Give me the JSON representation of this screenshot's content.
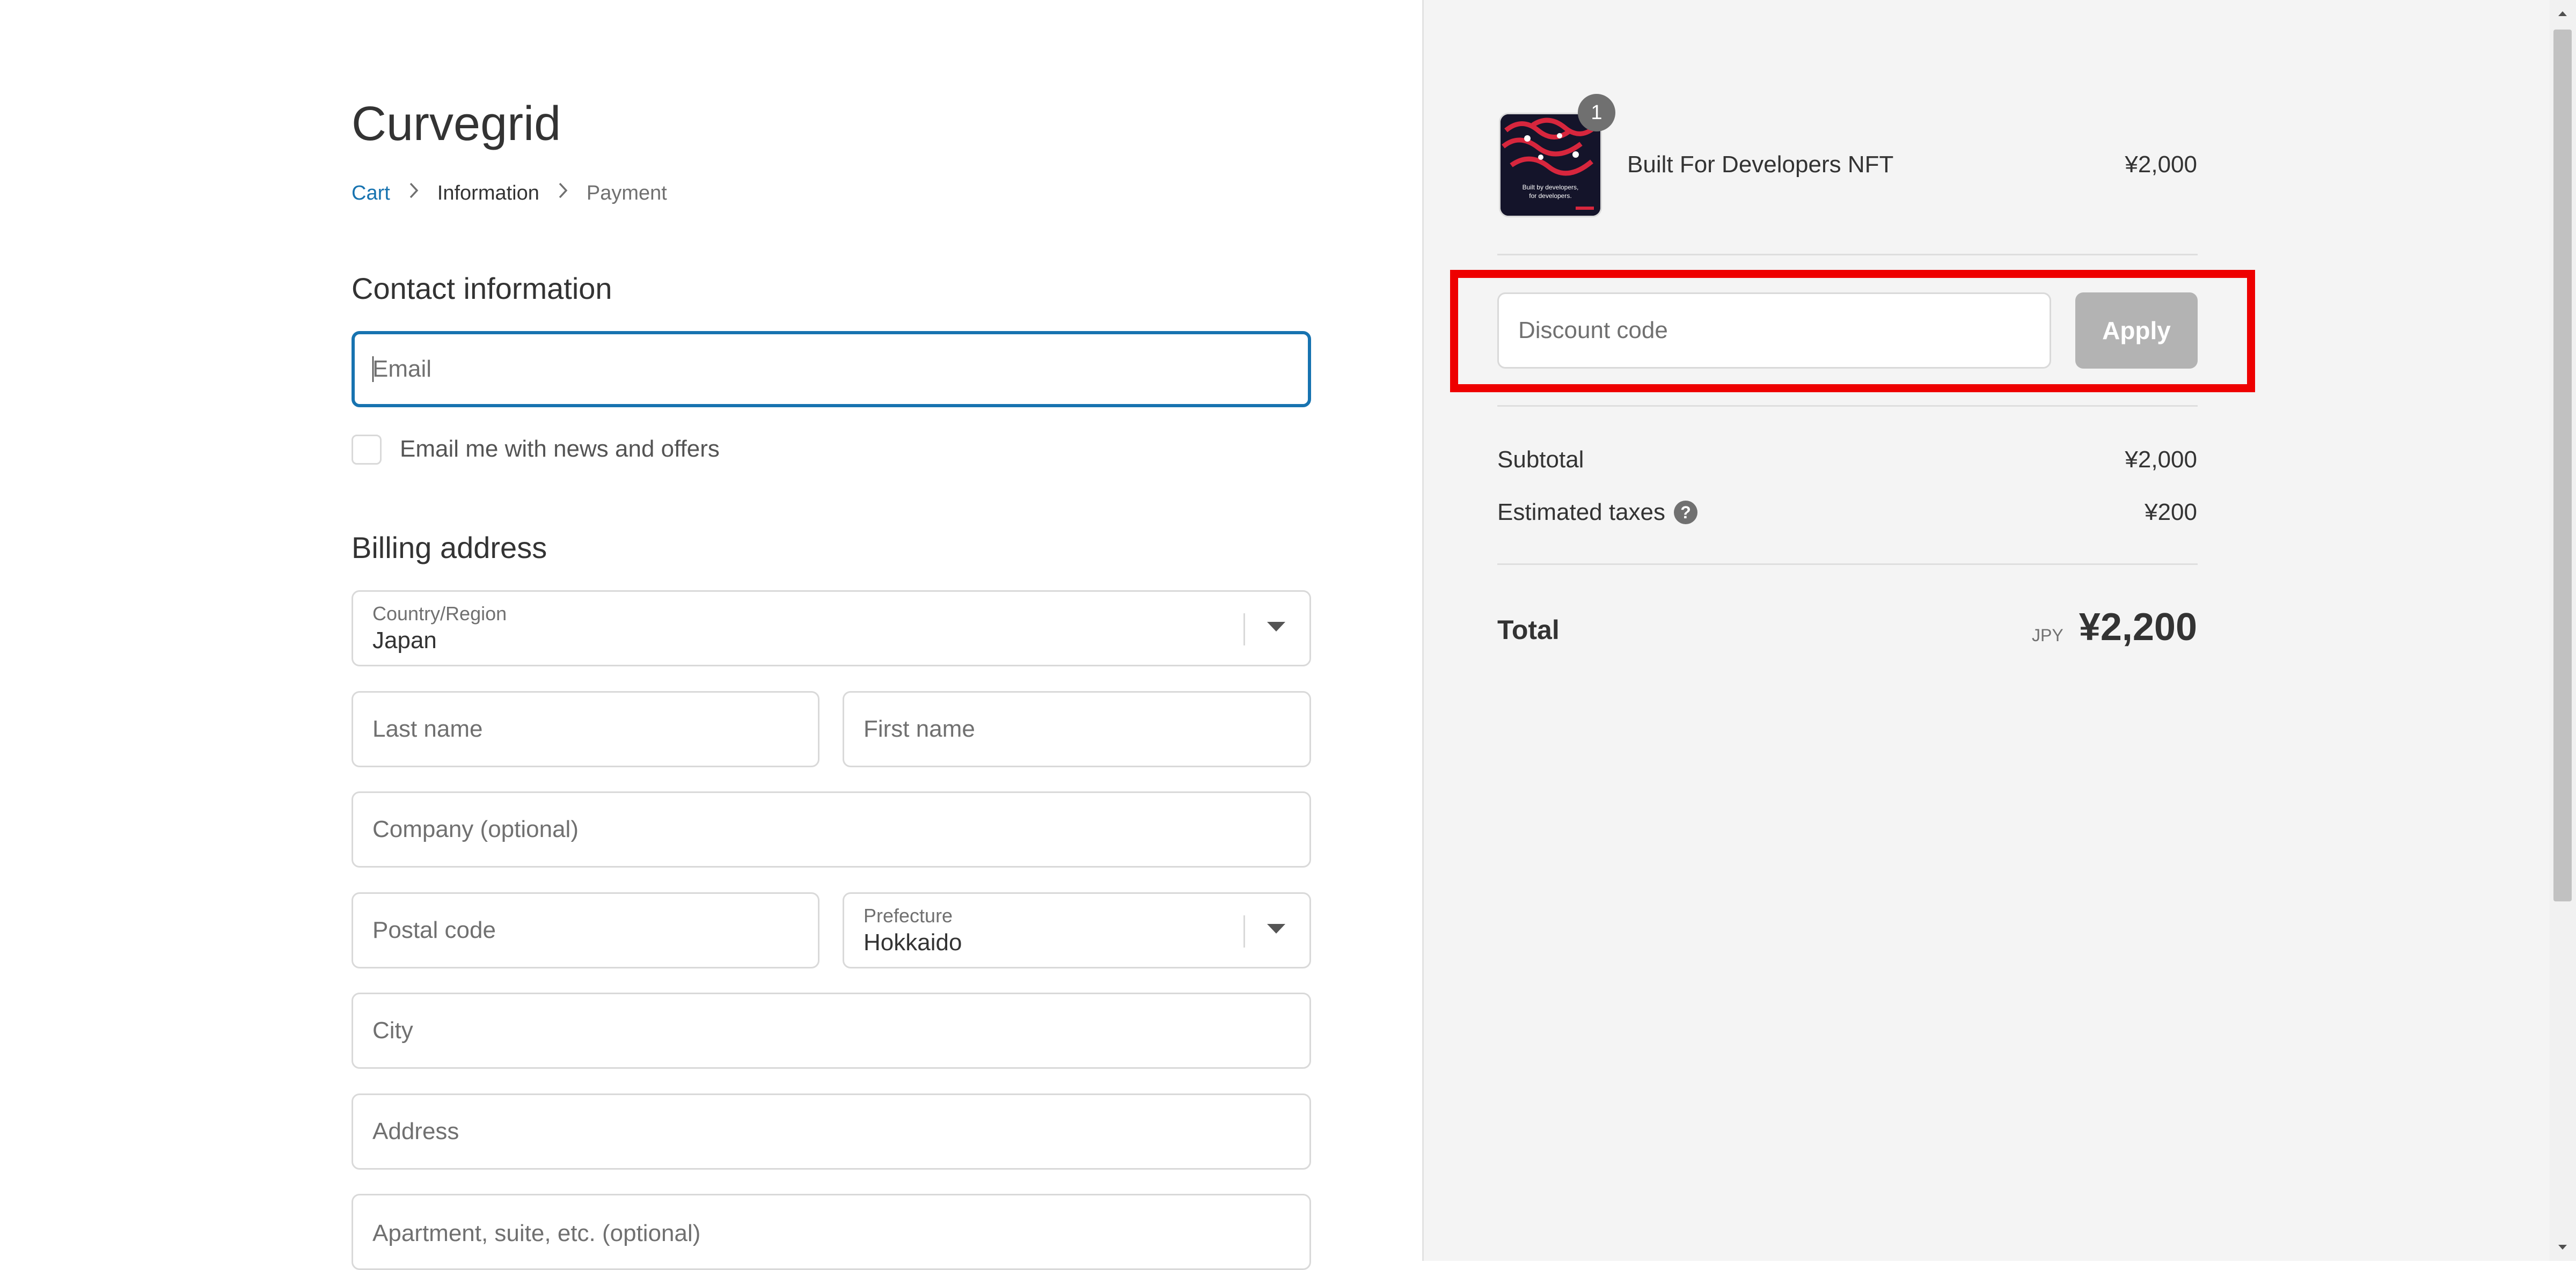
{
  "store": {
    "name": "Curvegrid"
  },
  "breadcrumb": [
    {
      "label": "Cart"
    },
    {
      "label": "Information"
    },
    {
      "label": "Payment"
    }
  ],
  "contact": {
    "title": "Contact information",
    "email_placeholder": "Email",
    "newsletter_label": "Email me with news and offers"
  },
  "billing": {
    "title": "Billing address",
    "country_label": "Country/Region",
    "country_value": "Japan",
    "last_name_placeholder": "Last name",
    "first_name_placeholder": "First name",
    "company_placeholder": "Company (optional)",
    "postal_placeholder": "Postal code",
    "prefecture_label": "Prefecture",
    "prefecture_value": "Hokkaido",
    "city_placeholder": "City",
    "address_placeholder": "Address",
    "apartment_placeholder": "Apartment, suite, etc. (optional)"
  },
  "order": {
    "item": {
      "name": "Built For Developers NFT",
      "price": "¥2,000",
      "quantity": "1",
      "thumb_text_1": "Built by developers,",
      "thumb_text_2": "for developers."
    },
    "discount_placeholder": "Discount code",
    "apply_label": "Apply",
    "subtotal_label": "Subtotal",
    "subtotal_value": "¥2,000",
    "taxes_label": "Estimated taxes",
    "taxes_value": "¥200",
    "total_label": "Total",
    "currency": "JPY",
    "total_value": "¥2,200"
  },
  "colors": {
    "accent": "#1773b0",
    "highlight": "#ee0000",
    "sidebar_bg": "#f4f4f4"
  },
  "icons": [
    "chevron-right-icon",
    "chevron-down-icon",
    "help-icon"
  ]
}
